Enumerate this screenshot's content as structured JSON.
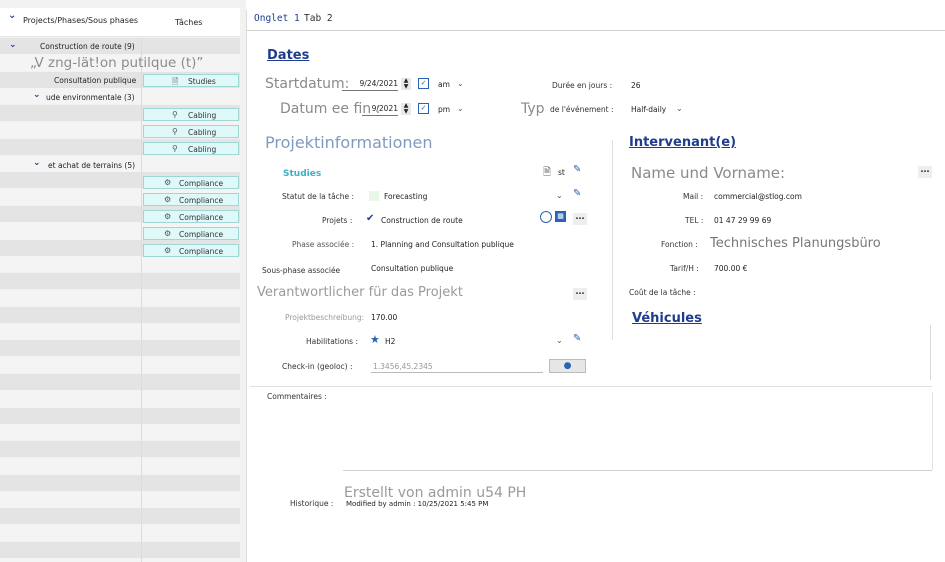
{
  "tree": {
    "header_col1": "Projects/Phases/Sous phases",
    "header_col2": "Tâches",
    "project": "Construction de route (9)",
    "phase1_overlay": "„V zng-lät!on putilque (t)”",
    "phase1_subphase": "Consultation publique",
    "phase1_task": "Studies",
    "phase2": "ude environmentale (3)",
    "phase2_tasks": [
      "Cabling",
      "Cabling",
      "Cabling"
    ],
    "phase3": "et achat de terrains (5)",
    "phase3_tasks": [
      "Compliance",
      "Compliance",
      "Compliance",
      "Compliance",
      "Compliance"
    ]
  },
  "tabs": [
    "Onglet 1",
    "Tab 2"
  ],
  "dates": {
    "title": "Dates",
    "start_label": "Startdatum:",
    "start_value": "9/24/2021",
    "start_ampm": "am",
    "end_label": "Datum ee fin :",
    "end_value": "9/2021",
    "end_ampm": "pm",
    "duration_label": "Durée en jours :",
    "duration_value": "26",
    "type_label_big": "Typ",
    "type_label_small": "de l'événement :",
    "type_value": "Half-daily"
  },
  "project_info": {
    "title": "Projektinformationen",
    "task_name": "Studies",
    "st_label": "st",
    "status_label": "Statut de la tâche :",
    "status_value": "Forecasting",
    "projects_label": "Projets :",
    "projects_value": "Construction de route",
    "phase_label": "Phase associée :",
    "phase_value": "1. Planning and Consultation publique",
    "subphase_label": "Sous-phase associée",
    "subphase_value": "Consultation publique",
    "responsible_label": "Verantwortlicher für das Projekt",
    "description_label": "Projektbeschreibung:",
    "description_value": "170.00",
    "habilitations_label": "Habilitations :",
    "habilitations_value": "H2",
    "checkin_label": "Check-in (geoloc) :",
    "checkin_value": "1.3456,45.2345"
  },
  "intervenant": {
    "title": "Intervenant(e)",
    "name_label": "Name und Vorname:",
    "mail_label": "Mail :",
    "mail_value": "commercial@stlog.com",
    "tel_label": "TEL :",
    "tel_value": "01 47 29 99 69",
    "fonction_label": "Fonction :",
    "fonction_value": "Technisches Planungsbüro",
    "tarif_label": "Tarif/H :",
    "tarif_value": "700.00 €",
    "cout_label": "Coût de la tâche :"
  },
  "vehicules": {
    "title": "Véhicules"
  },
  "comments": {
    "label": "Commentaires :"
  },
  "history": {
    "label": "Historique :",
    "value": "Modified by admin : 10/25/2021 5:45 PM",
    "overlay": "Erstellt von admin u54 PH"
  },
  "colors": {
    "accent": "#1f3d8c",
    "chip_bg": "#dff8f8",
    "chip_border": "#9fd6d6"
  }
}
